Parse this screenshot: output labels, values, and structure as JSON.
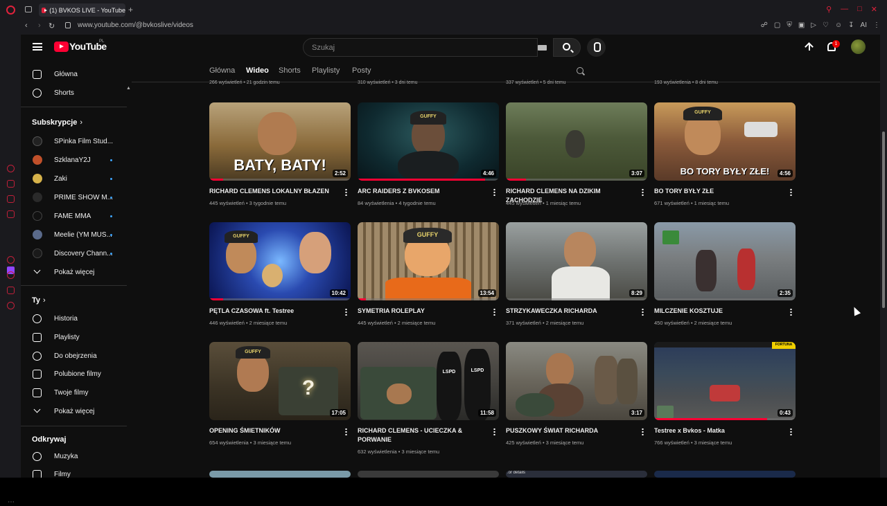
{
  "browser": {
    "tab_title": "(1) BVKOS LIVE - YouTube",
    "new_tab": "+",
    "url": "www.youtube.com/@bvkoslive/videos",
    "ext_ai": "AI"
  },
  "masthead": {
    "logo_text": "YouTube",
    "country": "PL",
    "search_placeholder": "Szukaj",
    "notification_count": "1"
  },
  "sidebar": {
    "main": [
      {
        "label": "Główna",
        "icon": "home-icon"
      },
      {
        "label": "Shorts",
        "icon": "shorts-icon"
      }
    ],
    "subs_heading": "Subskrypcje",
    "subs": [
      {
        "label": "SPinka Film Stud...",
        "color": "#222222"
      },
      {
        "label": "SzklanaY2J",
        "color": "#c0502a"
      },
      {
        "label": "Zaki",
        "color": "#d6b24a"
      },
      {
        "label": "PRIME SHOW M...",
        "color": "#2a2a2a"
      },
      {
        "label": "FAME MMA",
        "color": "#111111"
      },
      {
        "label": "Meelie (YM MUS...",
        "color": "#5a6a8a"
      },
      {
        "label": "Discovery Chann...",
        "color": "#1a1a1a"
      }
    ],
    "show_more_1": "Pokaż więcej",
    "you_heading": "Ty",
    "you_items": [
      {
        "label": "Historia",
        "icon": "history-icon"
      },
      {
        "label": "Playlisty",
        "icon": "playlists-icon"
      },
      {
        "label": "Do obejrzenia",
        "icon": "watch-later-icon"
      },
      {
        "label": "Polubione filmy",
        "icon": "liked-icon"
      },
      {
        "label": "Twoje filmy",
        "icon": "your-videos-icon"
      }
    ],
    "show_more_2": "Pokaż więcej",
    "explore_heading": "Odkrywaj",
    "explore_items": [
      {
        "label": "Muzyka",
        "icon": "music-icon"
      },
      {
        "label": "Filmy",
        "icon": "movies-icon"
      }
    ]
  },
  "channel_tabs": [
    "Główna",
    "Wideo",
    "Shorts",
    "Playlisty",
    "Posty"
  ],
  "active_tab": "Wideo",
  "partial_row_meta": [
    "266 wyświetleń • 21 godzin temu",
    "310 wyświetleń • 3 dni temu",
    "337 wyświetleń • 5 dni temu",
    "193 wyświetlenia • 8 dni temu"
  ],
  "videos": [
    {
      "title": "RICHARD CLEMENS LOKALNY BŁAZEN",
      "meta": "445 wyświetleń • 3 tygodnie temu",
      "duration": "2:52",
      "thumb_text": "BATY, BATY!",
      "progress": 0.1
    },
    {
      "title": "ARC RAIDERS Z BVKOSEM",
      "meta": "84 wyświetlenia • 4 tygodnie temu",
      "duration": "4:46",
      "thumb_text": "",
      "progress": 0.9
    },
    {
      "title": "RICHARD CLEMENS NA DZIKIM ZACHODZIE",
      "meta": "445 wyświetleń • 1 miesiąc temu",
      "duration": "3:07",
      "thumb_text": "",
      "progress": 0.14
    },
    {
      "title": "BO TORY BYŁY ZŁE",
      "meta": "671 wyświetleń • 1 miesiąc temu",
      "duration": "4:56",
      "thumb_text": "BO TORY BYŁY ZŁE!",
      "progress": 0
    },
    {
      "title": "PĘTLA CZASOWA ft. Testree",
      "meta": "446 wyświetleń • 2 miesiące temu",
      "duration": "10:42",
      "thumb_text": "",
      "progress": 0.1
    },
    {
      "title": "SYMETRIA ROLEPLAY",
      "meta": "445 wyświetleń • 2 miesiące temu",
      "duration": "13:54",
      "thumb_text": "",
      "progress": 0.06
    },
    {
      "title": "STRZYKAWECZKA RICHARDA",
      "meta": "371 wyświetleń • 2 miesiące temu",
      "duration": "8:29",
      "thumb_text": "",
      "progress": 0
    },
    {
      "title": "MILCZENIE KOSZTUJE",
      "meta": "450 wyświetleń • 2 miesiące temu",
      "duration": "2:35",
      "thumb_text": "",
      "progress": 0
    },
    {
      "title": "OPENING ŚMIETNIKÓW",
      "meta": "654 wyświetlenia • 3 miesiące temu",
      "duration": "17:05",
      "thumb_text": "",
      "progress": 0
    },
    {
      "title": "RICHARD CLEMENS - UCIECZKA & PORWANIE",
      "meta": "632 wyświetlenia • 3 miesiące temu",
      "duration": "11:58",
      "thumb_text": "",
      "progress": 0
    },
    {
      "title": "PUSZKOWY ŚWIAT RICHARDA",
      "meta": "425 wyświetleń • 3 miesiące temu",
      "duration": "3:17",
      "thumb_text": "",
      "progress": 0
    },
    {
      "title": "Testree x Bvkos - Matka",
      "meta": "766 wyświetleń • 3 miesiące temu",
      "duration": "0:43",
      "thumb_text": "",
      "progress": 0.8
    }
  ],
  "cap_label": "GUFFY",
  "police_label": "LSPD",
  "fortuna_label": "FORTUNA",
  "bottom_partial_text": ".or details"
}
